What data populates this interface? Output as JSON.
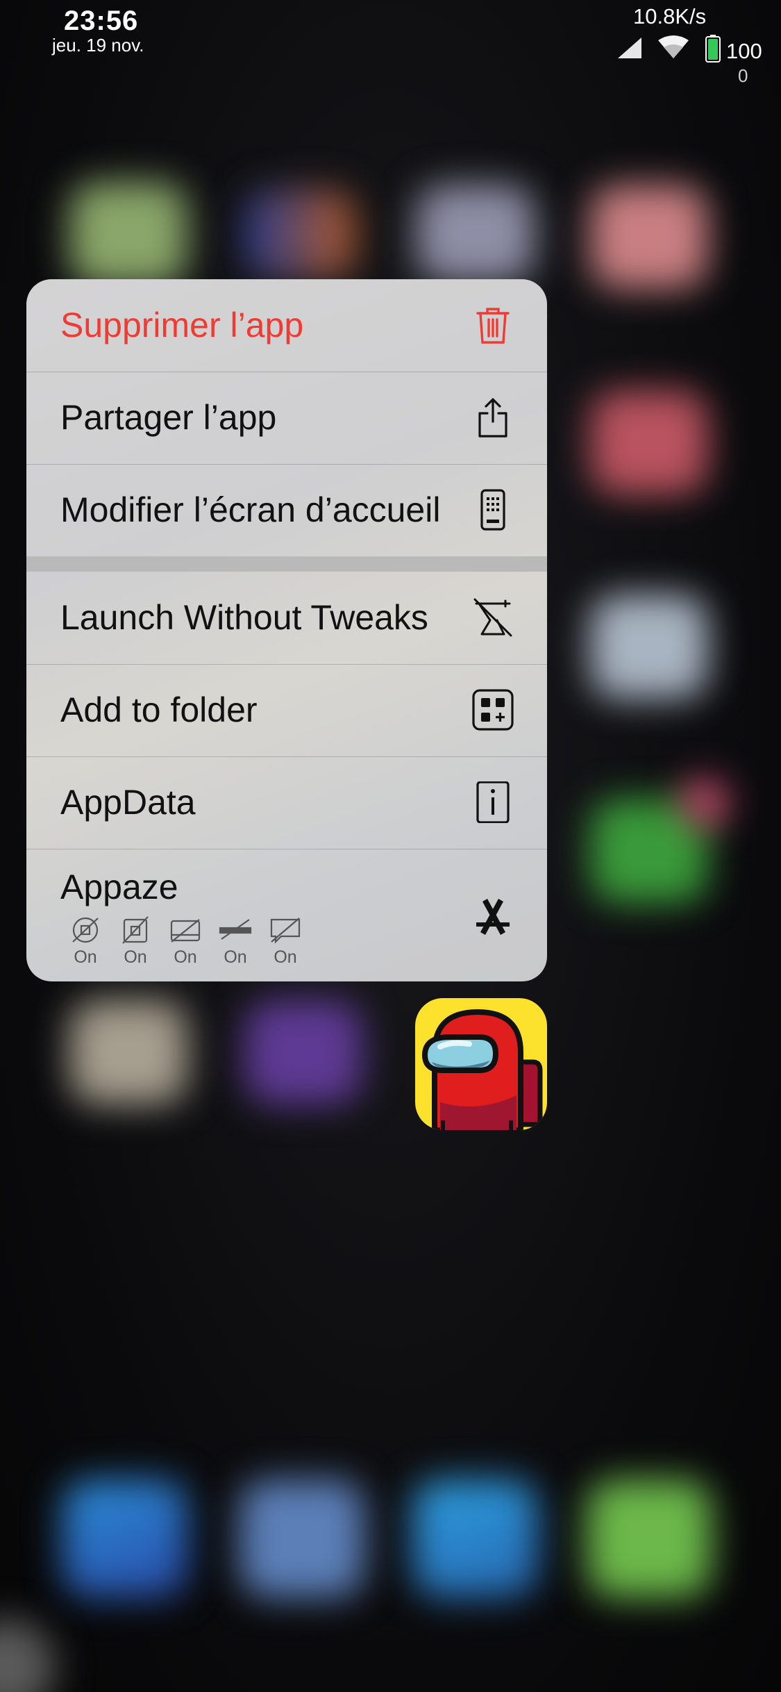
{
  "status_bar": {
    "time": "23:56",
    "date": "jeu. 19 nov.",
    "network_speed": "10.8K/s",
    "battery_level": "100",
    "battery_sub": "0"
  },
  "menu": {
    "items": [
      {
        "label": "Supprimer l’app",
        "icon": "trash-icon",
        "color": "#ef3b33"
      },
      {
        "label": "Partager l’app",
        "icon": "share-icon"
      },
      {
        "label": "Modifier l’écran d’accueil",
        "icon": "phone-grid-icon"
      },
      {
        "label": "Launch Without Tweaks",
        "icon": "no-tweaks-icon"
      },
      {
        "label": "Add to folder",
        "icon": "add-folder-icon"
      },
      {
        "label": "AppData",
        "icon": "info-icon"
      }
    ],
    "appaze": {
      "title": "Appaze",
      "icon": "app-store-icon",
      "toggles": [
        {
          "icon": "no-ads-circle-icon",
          "state": "On"
        },
        {
          "icon": "no-ads-square-icon",
          "state": "On"
        },
        {
          "icon": "no-banner-icon",
          "state": "On"
        },
        {
          "icon": "no-strip-icon",
          "state": "On"
        },
        {
          "icon": "no-popup-icon",
          "state": "On"
        }
      ]
    }
  },
  "app": {
    "name_icon": "among-us-app-icon",
    "brand_color": "#fde22d",
    "character_color": "#e01e1e"
  }
}
